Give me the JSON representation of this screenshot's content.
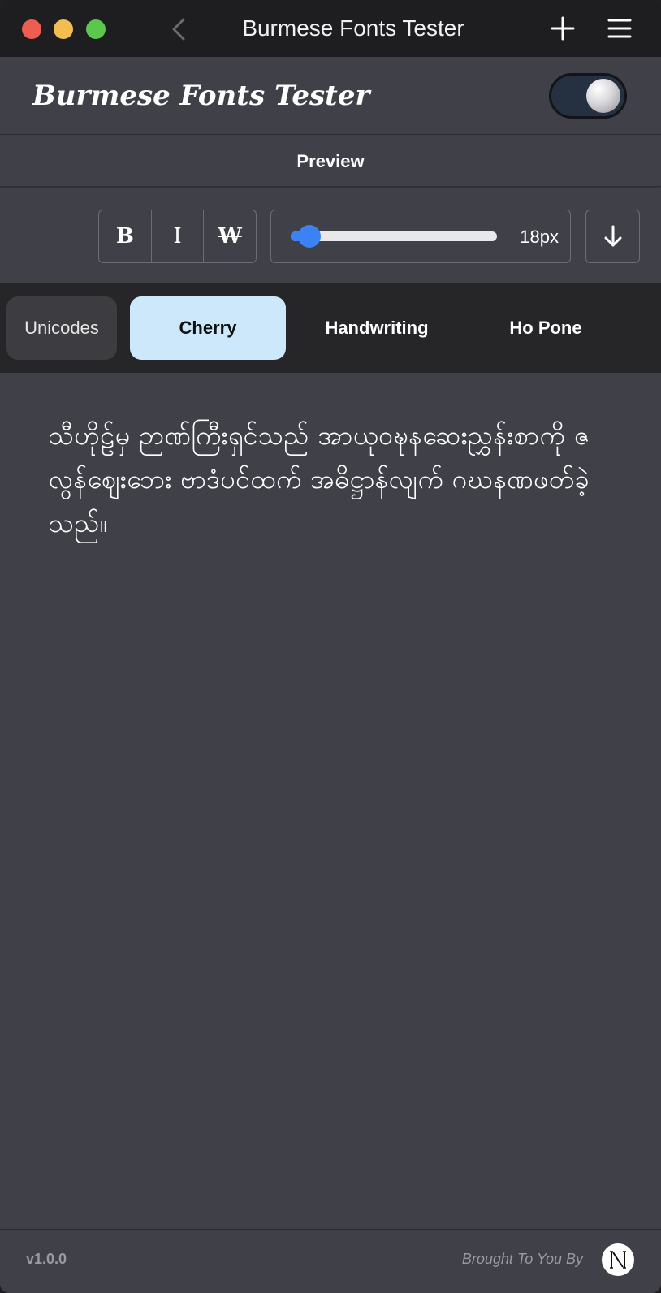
{
  "window": {
    "title": "Burmese Fonts Tester"
  },
  "header": {
    "app_title": "Burmese Fonts Tester",
    "theme_toggle_on": true
  },
  "preview": {
    "label": "Preview"
  },
  "toolbar": {
    "bold_label": "B",
    "italic_label": "I",
    "strike_label": "W",
    "font_size": 18,
    "font_size_label": "18px",
    "slider_fraction": 0.09
  },
  "tabs": [
    {
      "label": "Unicodes",
      "active": false
    },
    {
      "label": "Cherry",
      "active": true
    },
    {
      "label": "Handwriting",
      "active": false
    },
    {
      "label": "Ho Pone",
      "active": false
    }
  ],
  "sample_lines": [
    "သီဟိုဠ်မှ ဉာဏ်ကြီးရှင်သည် အာယုဝဍ္ဎနဆေးညွှန်းစာကို ဇလွန်ဈေးဘေး ဗာဒံပင်ထက် အဓိဋ္ဌာန်လျက် ဂဃနဏဖတ်ခဲ့သည်။"
  ],
  "footer": {
    "version": "v1.0.0",
    "credit": "Brought To You By",
    "logo_letter": "N"
  },
  "colors": {
    "accent": "#3b82f6",
    "active_tab": "#cde7fb",
    "background": "#404048"
  }
}
